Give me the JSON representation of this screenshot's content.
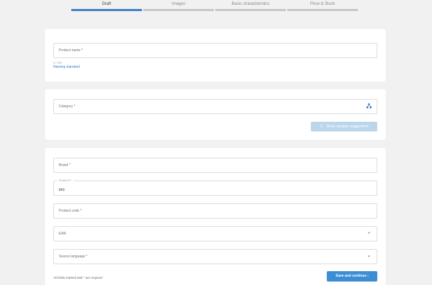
{
  "stepper": {
    "steps": [
      {
        "label": "Draft"
      },
      {
        "label": "Images"
      },
      {
        "label": "Basic characteristics"
      },
      {
        "label": "Price & Stock"
      }
    ]
  },
  "name_card": {
    "product_name_placeholder": "Product name *",
    "char_count": "0 / 200",
    "naming_link": "Naming standard"
  },
  "category_card": {
    "category_placeholder": "Category *",
    "suggest_button": "Show category suggestions"
  },
  "details_card": {
    "brand_placeholder": "Brand *",
    "product_id_label": "Product ID *",
    "product_id_value": "843",
    "product_code_placeholder": "Product code *",
    "ean_placeholder": "EAN",
    "source_language_placeholder": "Source language *",
    "required_note": "All fields marked with * are required",
    "save_button": "Save and continue",
    "save_button_arrow": "›"
  },
  "colors": {
    "accent": "#3b7dc4",
    "save_button_bg": "#3b8ed4",
    "suggest_button_bg": "#b9d6ec",
    "page_bg": "#f1f1f1"
  }
}
